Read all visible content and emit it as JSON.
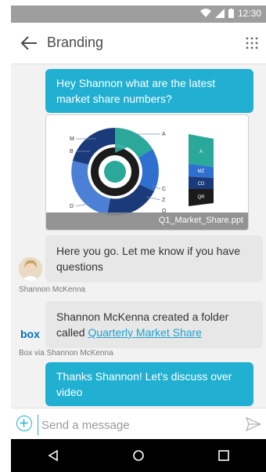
{
  "status": {
    "time": "12:30"
  },
  "header": {
    "title": "Branding"
  },
  "messages": {
    "m1": "Hey Shannon what are the latest market share numbers?",
    "attachment": {
      "file_name": "Q1_Market_Share.ppt",
      "chart_labels": [
        "M",
        "B",
        "D",
        "A",
        "C",
        "Z",
        "Q"
      ],
      "stack_labels": [
        "A",
        "MZ",
        "CD",
        "QR"
      ]
    },
    "m2": "Here you go. Let me know if you have questions",
    "m2_sender": "Shannon McKenna",
    "m3_text": "Shannon McKenna created a folder called ",
    "m3_link": "Quarterly Market Share",
    "m3_sender": "Box via Shannon McKenna",
    "box_logo": "box",
    "m4": "Thanks Shannon! Let's discuss over video"
  },
  "composer": {
    "placeholder": "Send a message"
  },
  "colors": {
    "accent": "#21b0d2",
    "teal": "#2aa89a",
    "navy": "#1b3a7a",
    "blue": "#2f6fd0",
    "dark": "#1b1b1b"
  }
}
